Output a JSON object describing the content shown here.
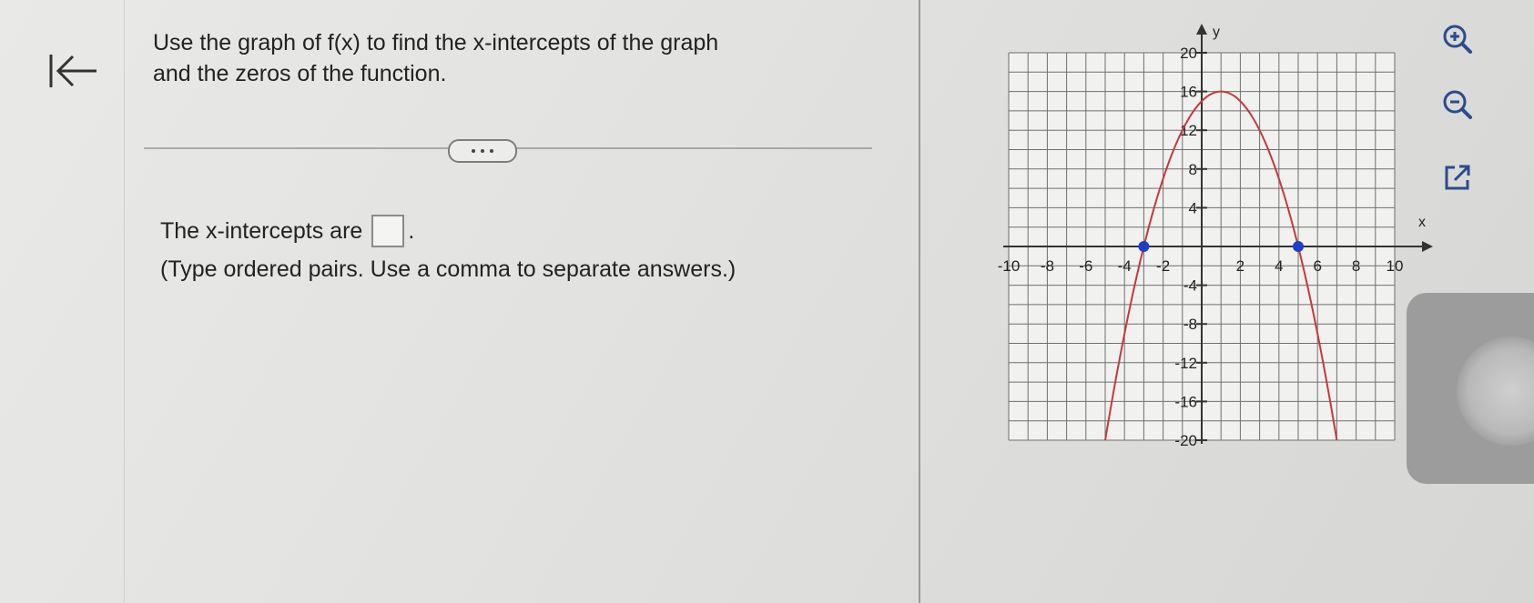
{
  "question": {
    "line1": "Use the graph of f(x) to find the x-intercepts of the graph",
    "line2": "and the zeros of the function."
  },
  "answer": {
    "prompt": "The x-intercepts are",
    "suffix": ".",
    "hint": "(Type ordered pairs. Use a comma to separate answers.)"
  },
  "chart_data": {
    "type": "line",
    "title": "",
    "xlabel": "x",
    "ylabel": "y",
    "xlim": [
      -10,
      10
    ],
    "ylim": [
      -20,
      20
    ],
    "grid": true,
    "x_ticks": [
      -10,
      -8,
      -6,
      -4,
      -2,
      2,
      4,
      6,
      8,
      10
    ],
    "y_ticks": [
      20,
      16,
      12,
      8,
      4,
      -4,
      -8,
      -12,
      -16,
      -20
    ],
    "x_tick_labels": [
      "-10",
      "-8",
      "-6",
      "-4",
      "-2",
      "2",
      "4",
      "6",
      "8",
      "10"
    ],
    "y_tick_labels": [
      "20",
      "16",
      "12",
      "8",
      "4",
      "-4",
      "-8",
      "-12",
      "-16",
      "-20"
    ],
    "series": [
      {
        "color": "#c43a3a",
        "function": "f(x) = -(x+3)(x-5)",
        "x": [
          -5.3,
          -5,
          -4,
          -3,
          -2,
          -1,
          0,
          1,
          2,
          3,
          4,
          5,
          6,
          7,
          7.2
        ],
        "y": [
          -24.2,
          -20,
          -9,
          0,
          7,
          12,
          15,
          16,
          15,
          12,
          7,
          0,
          -9,
          -20,
          -22.1
        ]
      }
    ],
    "points": [
      {
        "x": -3,
        "y": 0,
        "color": "#1f3fc8"
      },
      {
        "x": 5,
        "y": 0,
        "color": "#1f3fc8"
      }
    ]
  },
  "tools": {
    "zoom_in": "zoom-in-icon",
    "zoom_out": "zoom-out-icon",
    "popout": "popout-icon"
  }
}
